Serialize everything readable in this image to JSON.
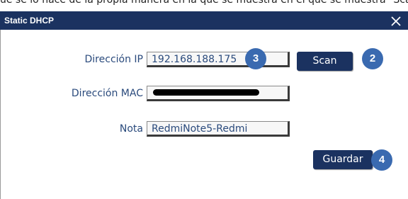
{
  "background_text": "ue se lo hace de la propia manera en la que se muestra en el que se muestra \"Scan\"",
  "dialog": {
    "title": "Static DHCP",
    "close_label": "×"
  },
  "form": {
    "ip_label": "Dirección IP",
    "ip_value": "192.168.188.175",
    "mac_label": "Dirección MAC",
    "mac_value": "",
    "note_label": "Nota",
    "note_value": "RedmiNote5-Redmi"
  },
  "buttons": {
    "scan": "Scan",
    "save": "Guardar"
  },
  "badges": {
    "ip": "3",
    "scan": "2",
    "save": "4"
  },
  "colors": {
    "titlebar": "#1b3260",
    "button": "#1b3260",
    "label": "#2a4a7c",
    "badge": "#3a6ab0"
  }
}
